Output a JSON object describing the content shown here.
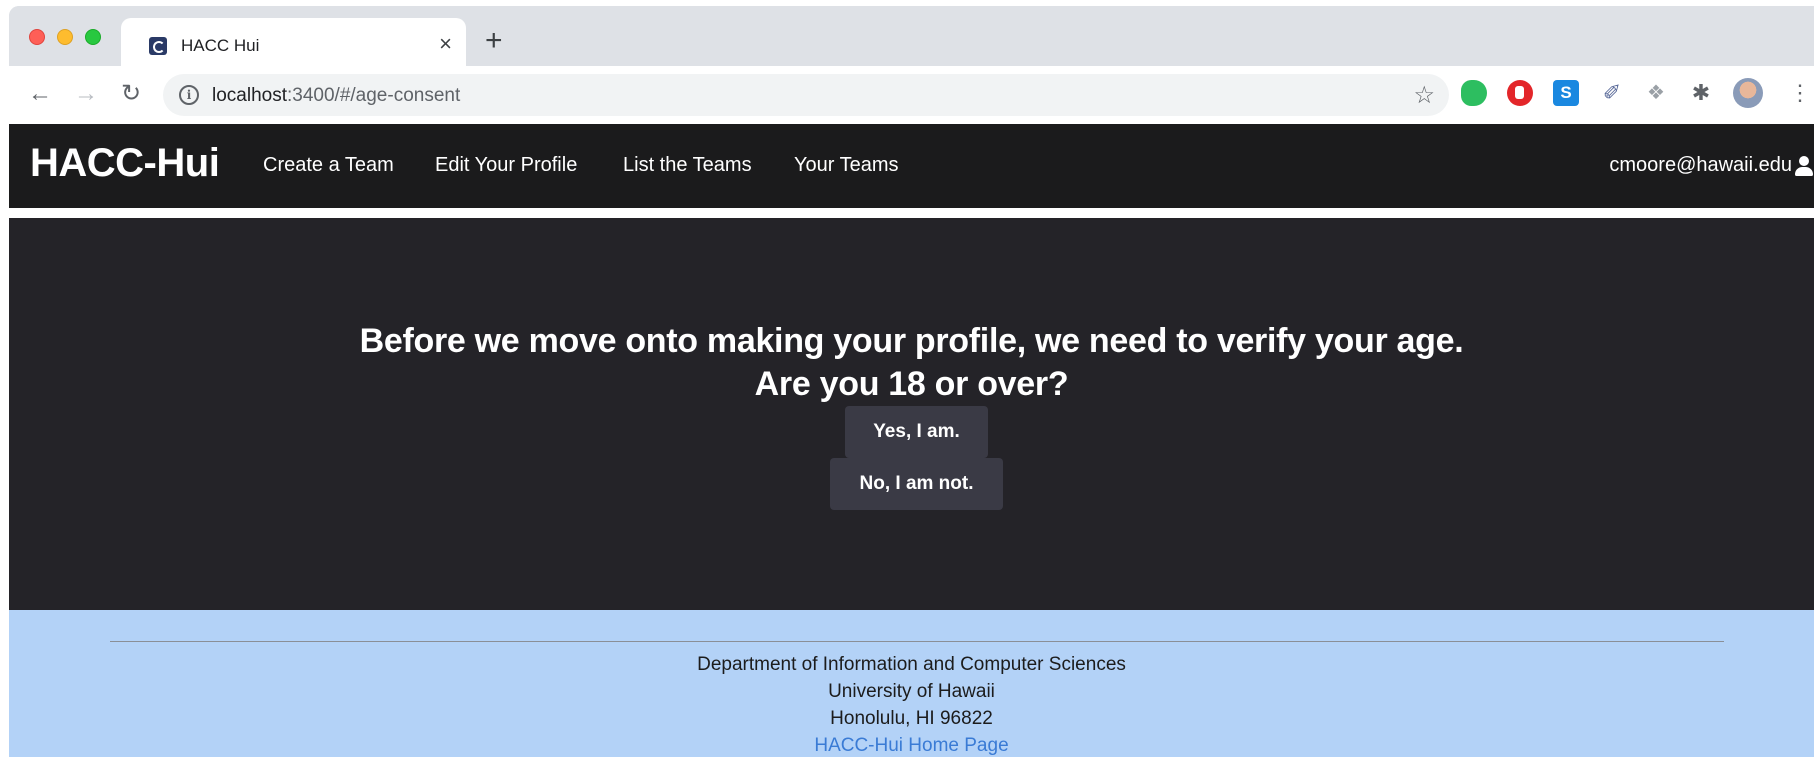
{
  "browser": {
    "tab_title": "HACC Hui",
    "tab_close": "×",
    "new_tab": "+",
    "url_host": "localhost",
    "url_rest": ":3400/#/age-consent",
    "ext_s_label": "S"
  },
  "navbar": {
    "brand": "HACC-Hui",
    "links": [
      "Create a Team",
      "Edit Your Profile",
      "List the Teams",
      "Your Teams"
    ],
    "user_email": "cmoore@hawaii.edu"
  },
  "consent": {
    "line1": "Before we move onto making your profile, we need to verify your age.",
    "line2": "Are you 18 or over?",
    "yes_label": "Yes, I am.",
    "no_label": "No, I am not."
  },
  "footer": {
    "department": "Department of Information and Computer Sciences",
    "university": "University of Hawaii",
    "address": "Honolulu, HI 96822",
    "home_link": "HACC-Hui Home Page"
  },
  "colors": {
    "navbar_bg": "#1b1b1c",
    "hero_bg": "#242328",
    "button_bg": "#3a3a45",
    "footer_bg": "#b3d2f7",
    "link": "#3a7bd5"
  }
}
